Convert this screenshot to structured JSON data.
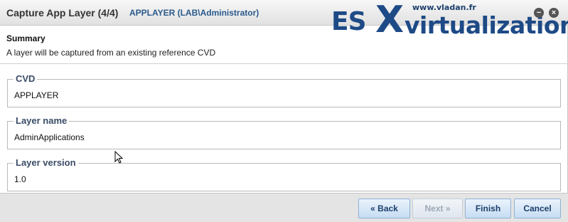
{
  "dialog": {
    "title": "Capture App Layer (4/4)",
    "subtitle": "APPLAYER (LAB\\Administrator)",
    "minimize_icon": "minus-circle-icon",
    "close_icon": "close-circle-icon",
    "minimize_glyph": "−",
    "close_glyph": "×"
  },
  "watermark": {
    "url": "www.vladan.fr",
    "brand_es": "ES",
    "brand_x": "X",
    "brand_rest": "virtualization",
    "color": "#1e4a86"
  },
  "summary": {
    "title": "Summary",
    "description": "A layer will be captured from an existing reference CVD"
  },
  "fields": {
    "cvd": {
      "label": "CVD",
      "value": "APPLAYER"
    },
    "layer_name": {
      "label": "Layer name",
      "value": "AdminApplications"
    },
    "layer_version": {
      "label": "Layer version",
      "value": "1.0"
    }
  },
  "footer": {
    "back": "« Back",
    "next": "Next »",
    "finish": "Finish",
    "cancel": "Cancel"
  },
  "colors": {
    "accent": "#2a5a8c",
    "button_text": "#1c3f6b",
    "legend": "#3a4c66"
  }
}
